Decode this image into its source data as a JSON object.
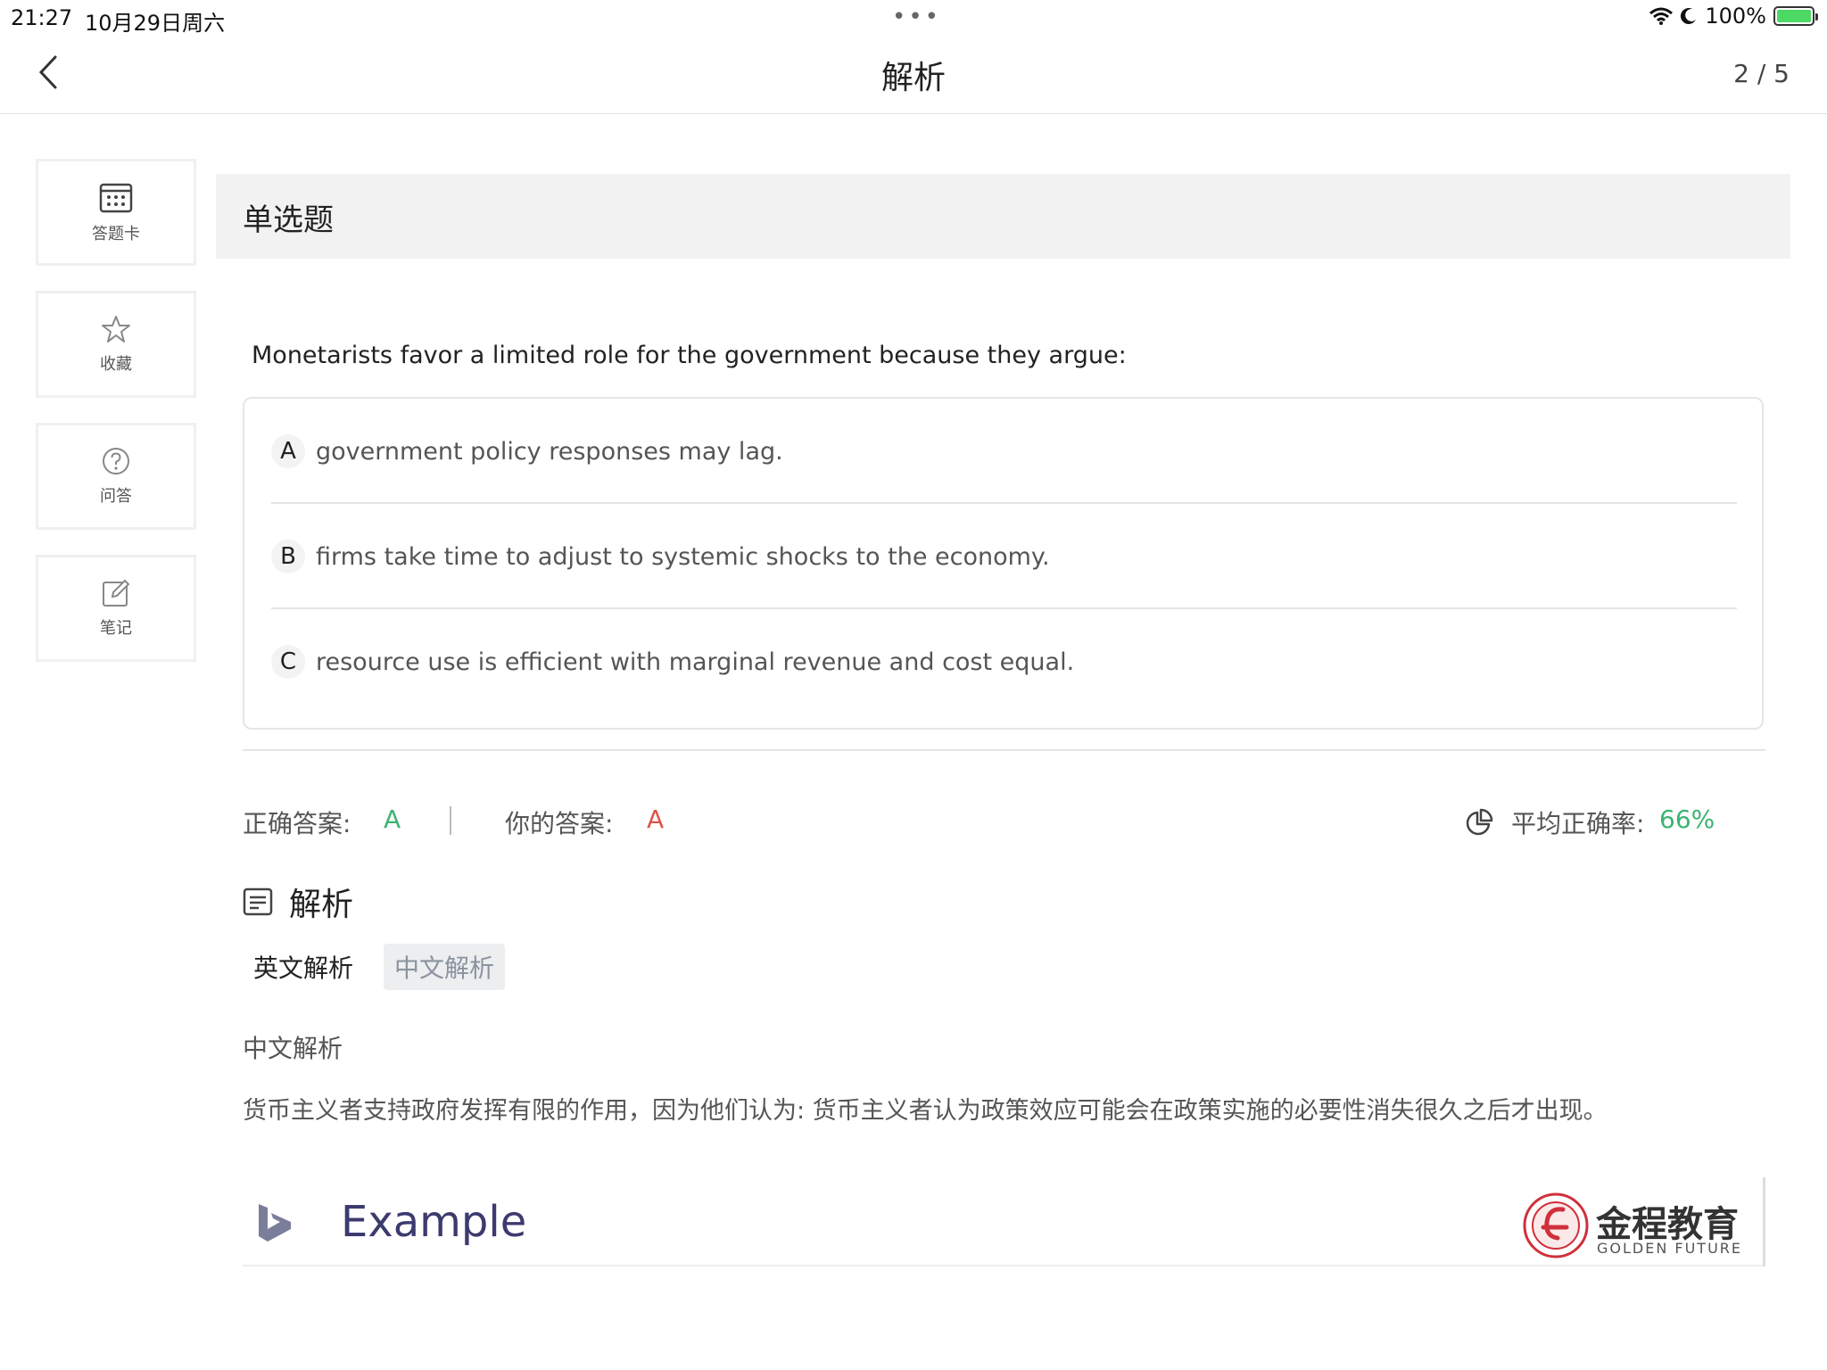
{
  "status_bar": {
    "time": "21:27",
    "date": "10月29日周六",
    "battery": "100%",
    "battery_level": 1.0
  },
  "nav": {
    "title": "解析",
    "page_indicator": "2 / 5"
  },
  "sidebar": {
    "items": [
      {
        "label": "答题卡",
        "icon": "answer-sheet-icon"
      },
      {
        "label": "收藏",
        "icon": "star-icon"
      },
      {
        "label": "问答",
        "icon": "question-icon"
      },
      {
        "label": "笔记",
        "icon": "note-edit-icon"
      }
    ]
  },
  "question": {
    "type": "单选题",
    "text": "Monetarists favor a limited role for the government because they argue:",
    "options": [
      {
        "letter": "A",
        "text": "government policy responses may lag."
      },
      {
        "letter": "B",
        "text": "firms take time to adjust to systemic shocks to the economy."
      },
      {
        "letter": "C",
        "text": "resource use is efficient with marginal revenue and cost equal."
      }
    ]
  },
  "answers": {
    "correct_label": "正确答案:",
    "correct_value": "A",
    "yours_label": "你的答案:",
    "yours_value": "A",
    "avg_label": "平均正确率:",
    "avg_value": "66%"
  },
  "analysis": {
    "heading": "解析",
    "tabs": [
      {
        "label": "英文解析",
        "active": false
      },
      {
        "label": "中文解析",
        "active": true
      }
    ],
    "section_title": "中文解析",
    "body": "货币主义者支持政府发挥有限的作用，因为他们认为: 货币主义者认为政策效应可能会在政策实施的必要性消失很久之后才出现。"
  },
  "example_banner": {
    "word": "Example",
    "brand_cn": "金程教育",
    "brand_en": "GOLDEN FUTURE"
  },
  "colors": {
    "correct": "#3cb371",
    "yours": "#e0524a",
    "avg": "#3cb371"
  }
}
